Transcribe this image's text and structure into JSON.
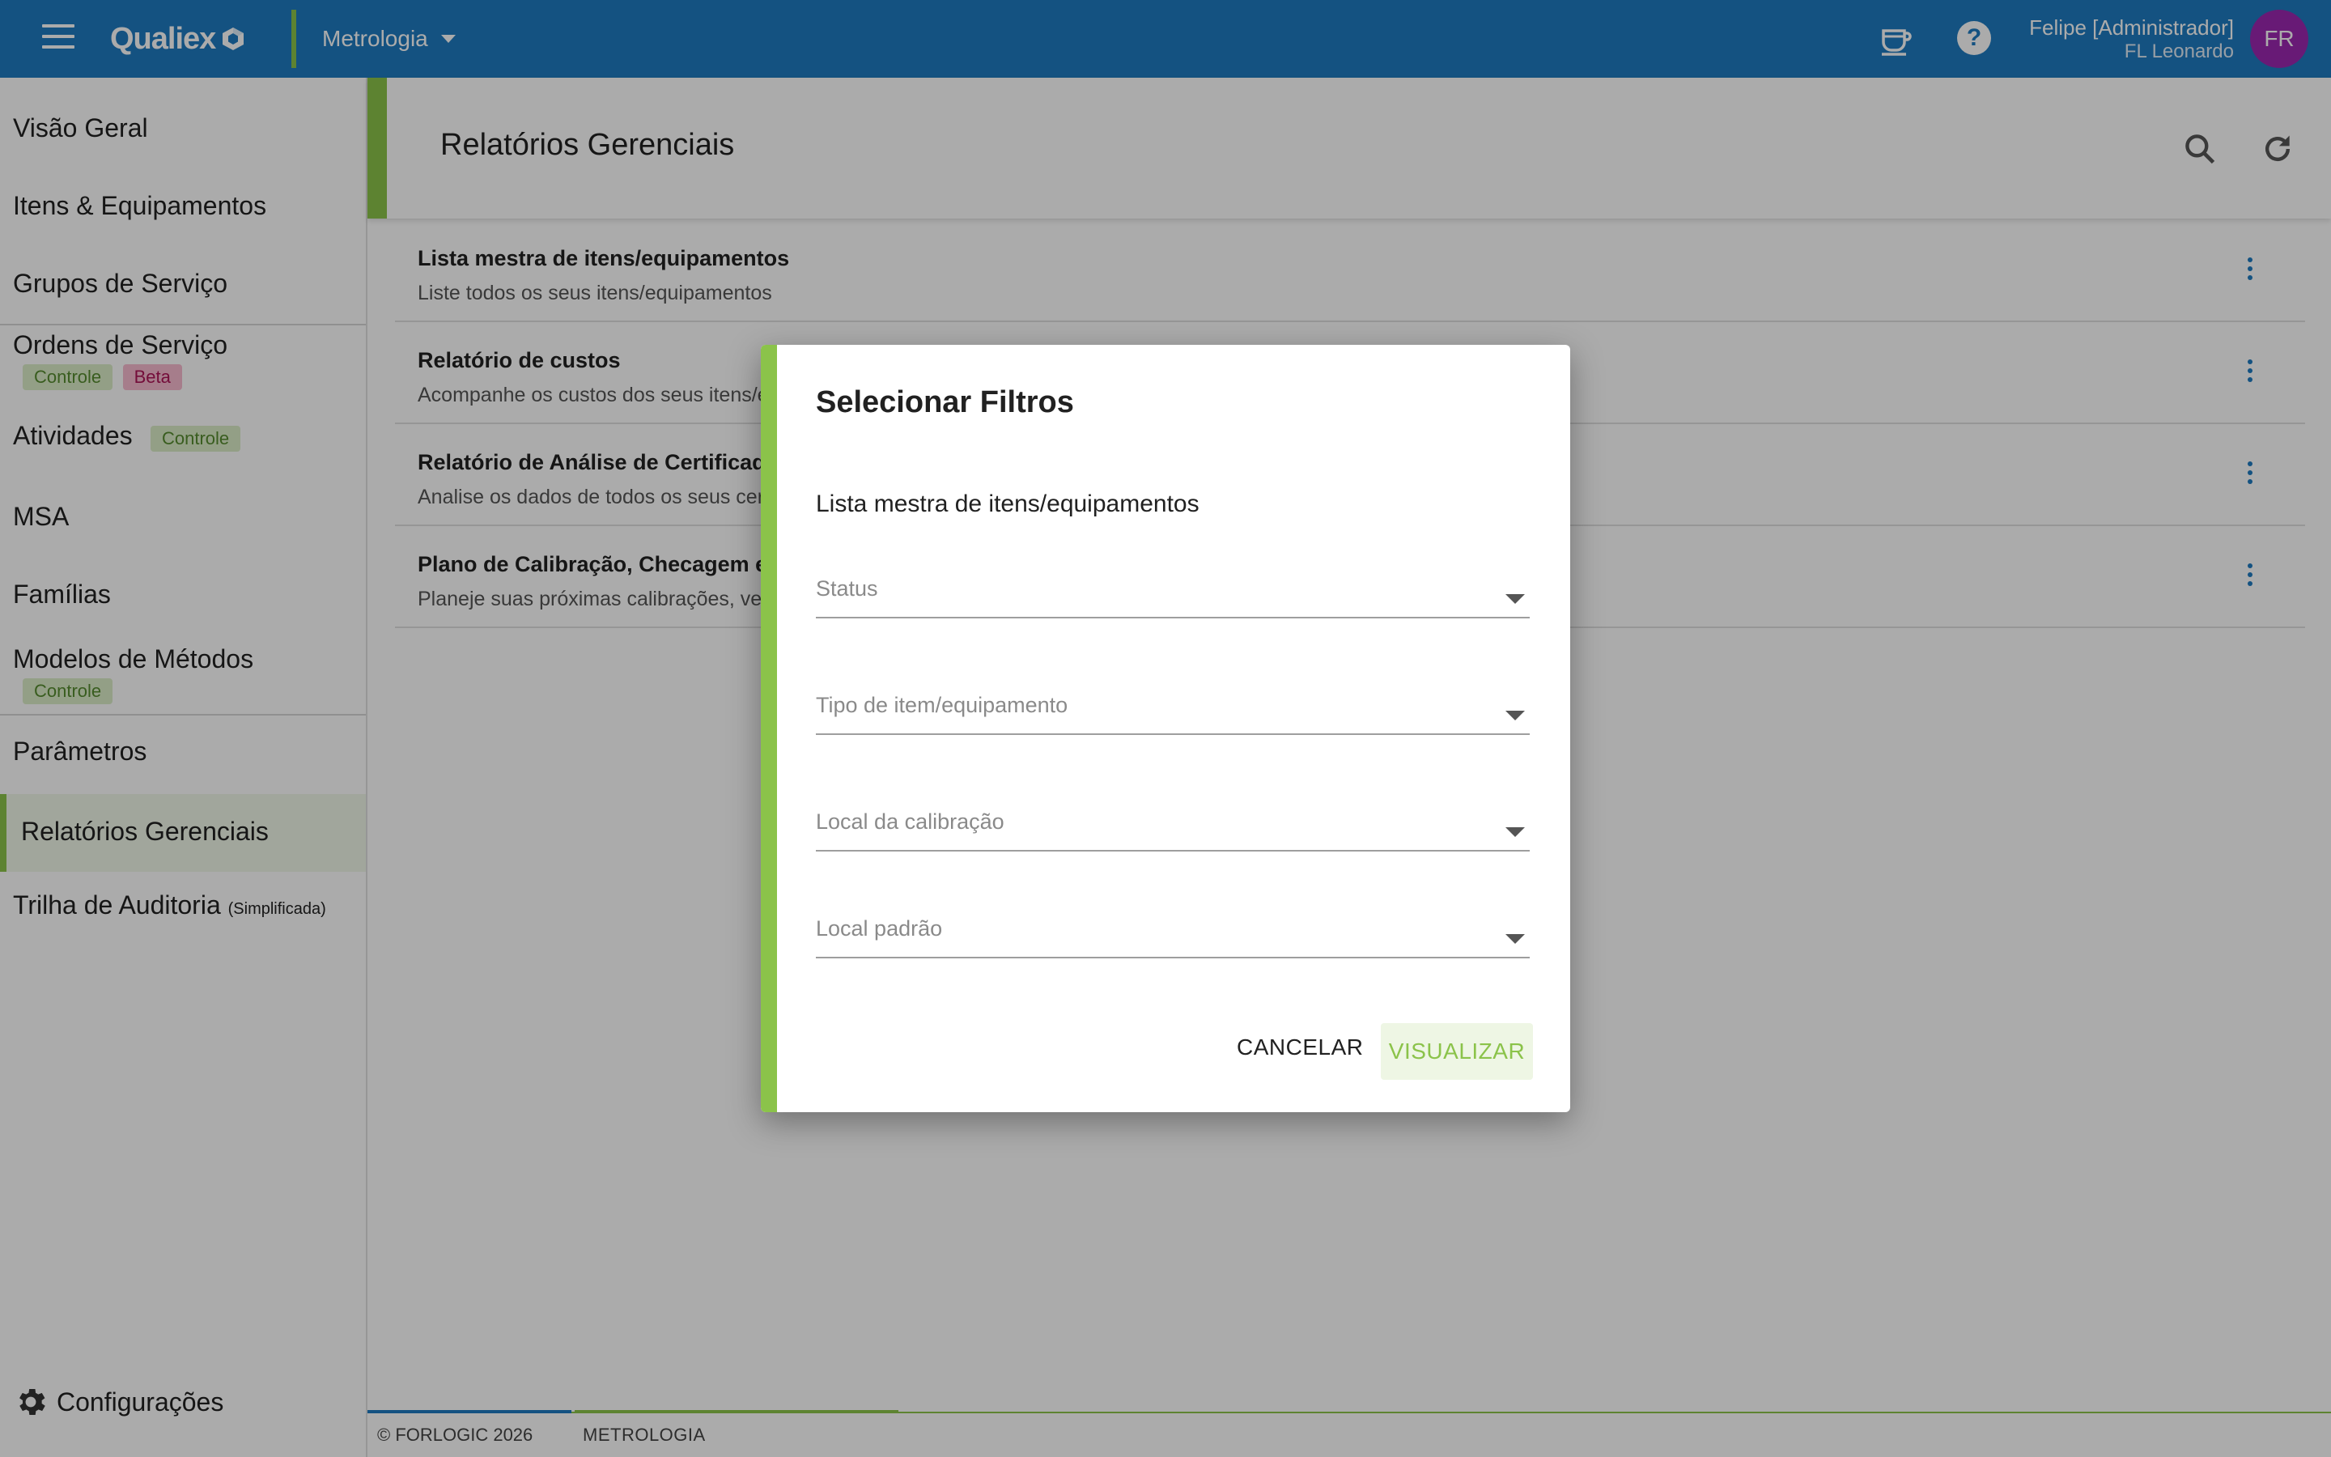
{
  "topbar": {
    "app_name": "Qualiex",
    "module": "Metrologia",
    "user_name": "Felipe [Administrador]",
    "user_org": "FL Leonardo",
    "avatar_initials": "FR",
    "help_glyph": "?",
    "colors": {
      "bar": "#1f7bc0",
      "accent": "#8bc34a",
      "avatar": "#9c27b0"
    }
  },
  "sidebar": {
    "items": [
      {
        "label": "Visão Geral"
      },
      {
        "label": "Itens & Equipamentos"
      },
      {
        "label": "Grupos de Serviço"
      },
      {
        "label": "Ordens de Serviço",
        "badges": [
          "Controle",
          "Beta"
        ]
      },
      {
        "label": "Atividades",
        "badges": [
          "Controle"
        ]
      },
      {
        "label": "MSA"
      },
      {
        "label": "Famílias"
      },
      {
        "label": "Modelos de Métodos",
        "badges": [
          "Controle"
        ]
      },
      {
        "label": "Parâmetros"
      },
      {
        "label": "Relatórios Gerenciais",
        "active": true
      },
      {
        "label": "Trilha de Auditoria",
        "suffix": "(Simplificada)"
      }
    ],
    "settings_label": "Configurações"
  },
  "main": {
    "title": "Relatórios Gerenciais",
    "reports": [
      {
        "title": "Lista mestra de itens/equipamentos",
        "description": "Liste todos os seus itens/equipamentos"
      },
      {
        "title": "Relatório de custos",
        "description": "Acompanhe os custos dos seus itens/e"
      },
      {
        "title": "Relatório de Análise de Certificado",
        "description": "Analise os dados de todos os seus cert"
      },
      {
        "title": "Plano de Calibração, Checagem e",
        "description": "Planeje suas próximas calibrações, veri"
      }
    ]
  },
  "footer": {
    "copyright": "© FORLOGIC 2026",
    "module": "METROLOGIA"
  },
  "dialog": {
    "title": "Selecionar Filtros",
    "subtitle": "Lista mestra de itens/equipamentos",
    "fields": [
      {
        "placeholder": "Status"
      },
      {
        "placeholder": "Tipo de item/equipamento"
      },
      {
        "placeholder": "Local da calibração"
      },
      {
        "placeholder": "Local padrão"
      }
    ],
    "cancel_label": "CANCELAR",
    "view_label": "VISUALIZAR"
  }
}
